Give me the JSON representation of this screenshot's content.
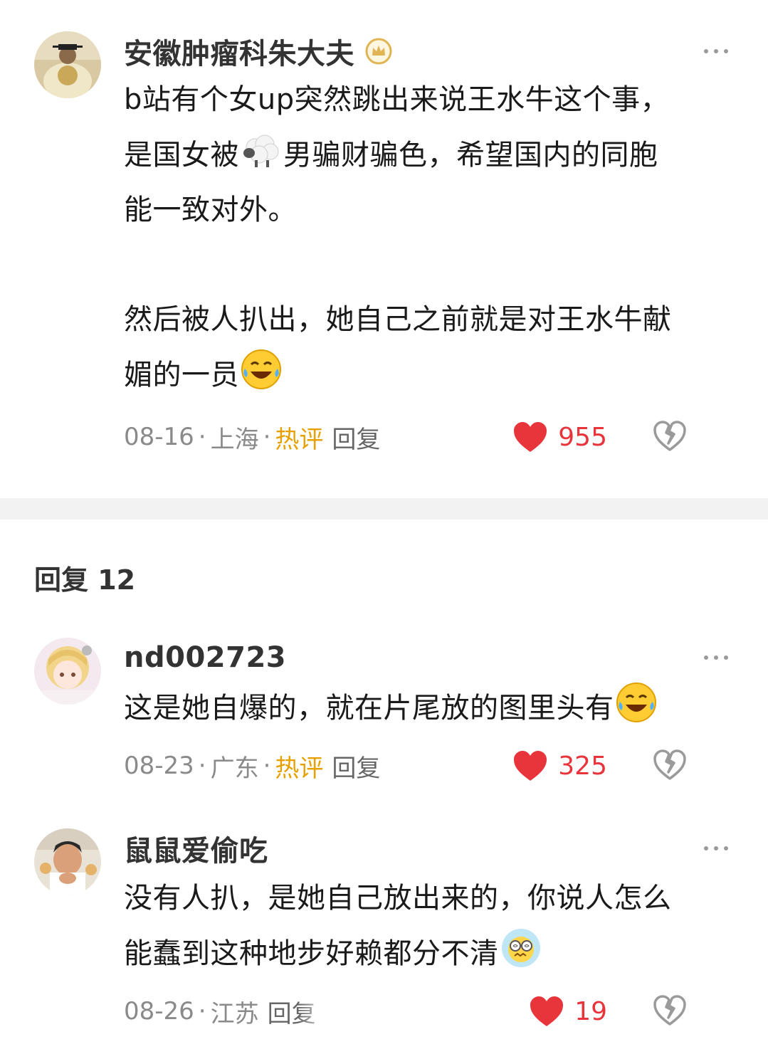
{
  "main_comment": {
    "author": "安徽肿瘤科朱大夫",
    "lines": [
      "b站有个女up突然跳出来说王水牛这个事，",
      "是国女被",
      "男骗财骗色，希望国内的同胞",
      "能一致对外。",
      "然后被人扒出，她自己之前就是对王水牛献",
      "媚的一员"
    ],
    "date": "08-16",
    "location": "上海",
    "hot_label": "热评",
    "reply_label": "回复",
    "likes": "955"
  },
  "replies_header": "回复 12",
  "replies": [
    {
      "author": "nd002723",
      "text": "这是她自爆的，就在片尾放的图里头有",
      "date": "08-23",
      "location": "广东",
      "hot_label": "热评",
      "reply_label": "回复",
      "likes": "325"
    },
    {
      "author": "鼠鼠爱偷吃",
      "lines": [
        "没有人扒，是她自己放出来的，你说人怎么",
        "能蠢到这种地步好赖都分不清"
      ],
      "date": "08-26",
      "location": "江苏",
      "reply_label": "回复",
      "likes": "19"
    }
  ],
  "separator": "·",
  "colors": {
    "like_red": "#e8353c",
    "hot_orange": "#e6a100",
    "meta_gray": "#8a8a8a"
  },
  "icons": [
    "crown-badge-icon",
    "more-icon",
    "heart-icon",
    "broken-heart-icon",
    "sheep-emoji",
    "laugh-cry-emoji",
    "dizzy-emoji"
  ]
}
